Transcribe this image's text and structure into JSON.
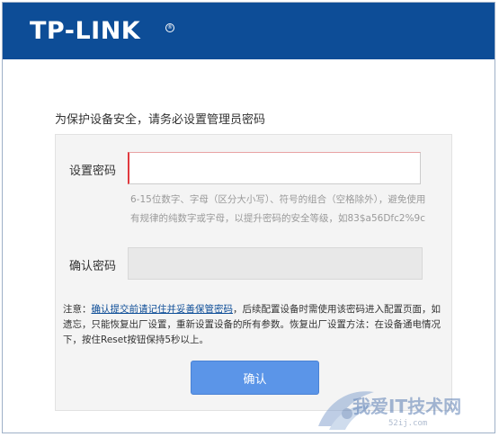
{
  "header": {
    "logo": "TP-LINK"
  },
  "intro": "为保护设备安全，请务必设置管理员密码",
  "form": {
    "password_label": "设置密码",
    "password_value": "",
    "hint": "6-15位数字、字母（区分大小写）、符号的组合（空格除外），避免使用有规律的纯数字或字母，以提升密码的安全等级，如83$a56Dfc2%9c",
    "confirm_label": "确认密码",
    "confirm_value": "",
    "note_prefix": "注意：",
    "note_link": "确认提交前请记住并妥善保管密码",
    "note_rest": "，后续配置设备时需使用该密码进入配置页面，如遗忘，只能恢复出厂设置，重新设置设备的所有参数。恢复出厂设置方法：在设备通电情况下，按住Reset按钮保持5秒以上。",
    "submit_label": "确认"
  },
  "watermark": {
    "text": "我爱IT技术网",
    "sub": "52ij.com"
  },
  "colors": {
    "header_bg": "#0d4d97",
    "button_bg": "#5b95e8",
    "link": "#0d4d97"
  }
}
